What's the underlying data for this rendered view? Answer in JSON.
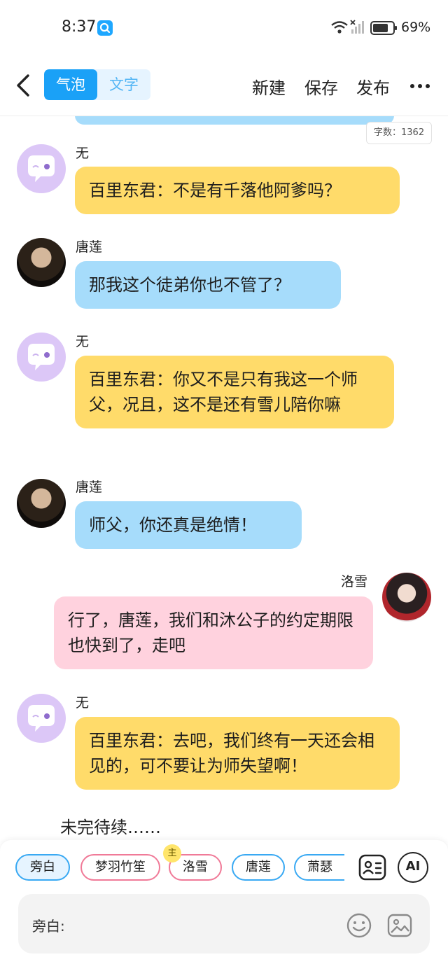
{
  "status_bar": {
    "time": "8:37",
    "battery": "69%"
  },
  "header": {
    "tabs": [
      {
        "label": "气泡",
        "selected": true
      },
      {
        "label": "文字",
        "selected": false
      }
    ],
    "new_label": "新建",
    "save_label": "保存",
    "publish_label": "发布"
  },
  "chat": {
    "word_count": "字数：1362",
    "messages": [
      {
        "speaker": "无",
        "text": "百里东君：不是有千落他阿爹吗？"
      },
      {
        "speaker": "唐莲",
        "text": "那我这个徒弟你也不管了？"
      },
      {
        "speaker": "无",
        "text": "百里东君：你又不是只有我这一个师父，况且，这不是还有雪儿陪你嘛"
      },
      {
        "speaker": "唐莲",
        "text": "师父，你还真是绝情！"
      },
      {
        "speaker": "洛雪",
        "text": "行了，唐莲，我们和沐公子的约定期限也快到了，走吧"
      },
      {
        "speaker": "无",
        "text": "百里东君：去吧，我们终有一天还会相见的，可不要让为师失望啊！"
      }
    ],
    "to_be_continued": "未完待续……"
  },
  "composer": {
    "roles": [
      {
        "label": "旁白",
        "selected": true,
        "color": "#39a9f3"
      },
      {
        "label": "梦羽竹笙",
        "selected": false,
        "color": "#f07a98"
      },
      {
        "label": "洛雪",
        "selected": false,
        "color": "#f07a98",
        "badge": "主"
      },
      {
        "label": "唐莲",
        "selected": false,
        "color": "#39a9f3"
      },
      {
        "label": "萧瑟",
        "selected": false,
        "color": "#39a9f3"
      }
    ],
    "ai_label": "AI",
    "input_label": "旁白:",
    "input_value": ""
  },
  "colors": {
    "accent": "#1aa1f7",
    "bubble_yellow": "#ffdb6a",
    "bubble_blue": "#a6dcfb",
    "bubble_pink": "#ffd2de",
    "avatar_blank": "#dcc7f7"
  }
}
